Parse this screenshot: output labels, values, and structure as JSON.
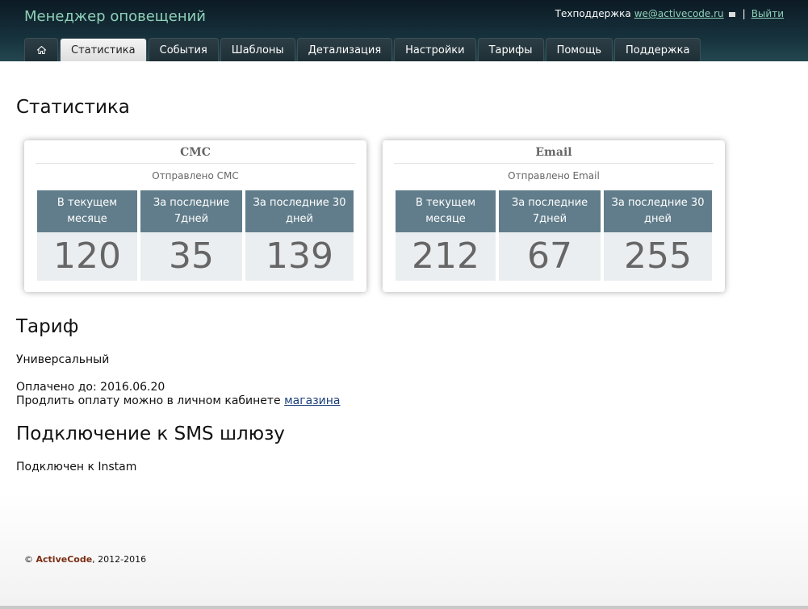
{
  "header": {
    "title": "Менеджер оповещений",
    "support_label": "Техподдержка",
    "support_email": "we@activecode.ru",
    "logout_label": "Выйти"
  },
  "tabs": [
    {
      "label": "Статистика",
      "active": true
    },
    {
      "label": "События"
    },
    {
      "label": "Шаблоны"
    },
    {
      "label": "Детализация"
    },
    {
      "label": "Настройки"
    },
    {
      "label": "Тарифы"
    },
    {
      "label": "Помощь"
    },
    {
      "label": "Поддержка"
    }
  ],
  "page_title": "Статистика",
  "cards": [
    {
      "title": "СМС",
      "subtitle": "Отправлено СМС",
      "stats": [
        {
          "label": "В текущем месяце",
          "value": "120"
        },
        {
          "label": "За последние 7дней",
          "value": "35"
        },
        {
          "label": "За последние 30 дней",
          "value": "139"
        }
      ]
    },
    {
      "title": "Email",
      "subtitle": "Отправлено Email",
      "stats": [
        {
          "label": "В текущем месяце",
          "value": "212"
        },
        {
          "label": "За последние 7дней",
          "value": "67"
        },
        {
          "label": "За последние 30 дней",
          "value": "255"
        }
      ]
    }
  ],
  "tariff": {
    "heading": "Тариф",
    "name": "Универсальный",
    "paid_until": "Оплачено до: 2016.06.20",
    "renew_text": "Продлить оплату можно в личном кабинете",
    "renew_link": "магазина"
  },
  "gateway": {
    "heading": "Подключение к SMS шлюзу",
    "status": "Подключен к Instam"
  },
  "footer": {
    "copyright": "©",
    "brand": "ActiveCode",
    "years": ", 2012-2016"
  },
  "colors": {
    "header_bg": "#16313c",
    "title_accent": "#8fd0b8",
    "stat_header": "#617d8b",
    "stat_value_bg": "#ebeef1",
    "brand": "#7a2d12"
  },
  "icons": {
    "home_tab": "home-icon",
    "email": "mail-icon"
  }
}
